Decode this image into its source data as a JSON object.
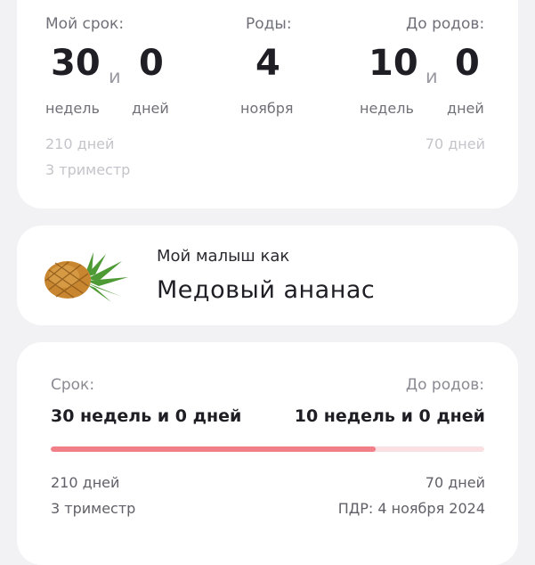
{
  "summary": {
    "term_label": "Мой срок:",
    "term_weeks": "30",
    "term_conj": "и",
    "term_days": "0",
    "weeks_unit": "недель",
    "days_unit": "дней",
    "birth_label": "Роды:",
    "birth_day": "4",
    "birth_month": "ноября",
    "remaining_label": "До родов:",
    "remaining_weeks": "10",
    "remaining_conj": "и",
    "remaining_days": "0",
    "total_days": "210 дней",
    "trimester": "3 триместр",
    "remaining_total_days": "70 дней"
  },
  "baby": {
    "caption": "Мой малыш как",
    "fruit_name": "Медовый ананас",
    "fruit_icon": "pineapple-icon"
  },
  "progress": {
    "term_label": "Срок:",
    "term_value": "30 недель и 0 дней",
    "remaining_label": "До родов:",
    "remaining_value": "10 недель и 0 дней",
    "fraction": 0.75,
    "total_days": "210 дней",
    "trimester": "3 триместр",
    "remaining_total_days": "70 дней",
    "due_date": "ПДР: 4 ноября 2024"
  },
  "colors": {
    "progress_fill": "#f27e88",
    "progress_track": "#fbe0e3",
    "background": "#f2f2f4"
  }
}
